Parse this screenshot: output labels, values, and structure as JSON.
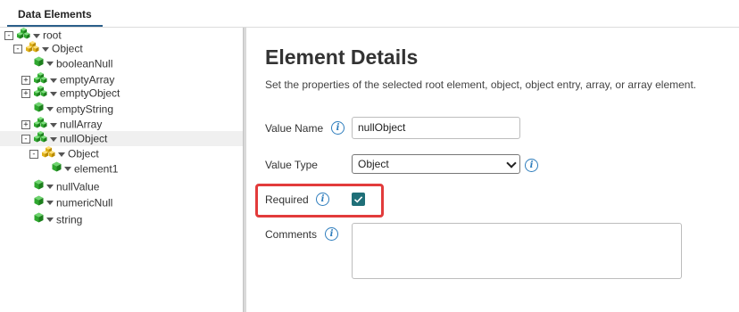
{
  "tabs": {
    "data_elements": "Data Elements"
  },
  "tree": {
    "nodes": [
      {
        "label": "root",
        "expander": "-",
        "icon": "green-cubes-icon"
      },
      {
        "label": "Object",
        "expander": "-",
        "icon": "yellow-cubes-icon"
      },
      {
        "label": "booleanNull",
        "expander": "",
        "icon": "green-cube-icon"
      },
      {
        "label": "emptyArray",
        "expander": "+",
        "icon": "green-cubes-icon"
      },
      {
        "label": "emptyObject",
        "expander": "+",
        "icon": "green-cubes-icon"
      },
      {
        "label": "emptyString",
        "expander": "",
        "icon": "green-cube-icon"
      },
      {
        "label": "nullArray",
        "expander": "+",
        "icon": "green-cubes-icon"
      },
      {
        "label": "nullObject",
        "expander": "-",
        "icon": "green-cubes-icon",
        "selected": true
      },
      {
        "label": "Object",
        "expander": "-",
        "icon": "yellow-cubes-icon"
      },
      {
        "label": "element1",
        "expander": "",
        "icon": "green-cube-icon"
      },
      {
        "label": "nullValue",
        "expander": "",
        "icon": "green-cube-icon"
      },
      {
        "label": "numericNull",
        "expander": "",
        "icon": "green-cube-icon"
      },
      {
        "label": "string",
        "expander": "",
        "icon": "green-cube-icon"
      }
    ]
  },
  "details": {
    "title": "Element Details",
    "subtitle": "Set the properties of the selected root element, object, object entry, array, or array element.",
    "value_name_label": "Value Name",
    "value_name": "nullObject",
    "value_type_label": "Value Type",
    "value_type": "Object",
    "required_label": "Required",
    "required_checked": true,
    "comments_label": "Comments",
    "comments": ""
  },
  "icons": {
    "info": "i",
    "check": "check-icon",
    "chevron": "chevron-down-icon"
  },
  "colors": {
    "accent": "#2b5f8a",
    "checkbox": "#1f6f78",
    "highlight": "#e23b3b",
    "cube_green": "#2fa82f",
    "cube_yellow": "#e0b21a"
  }
}
